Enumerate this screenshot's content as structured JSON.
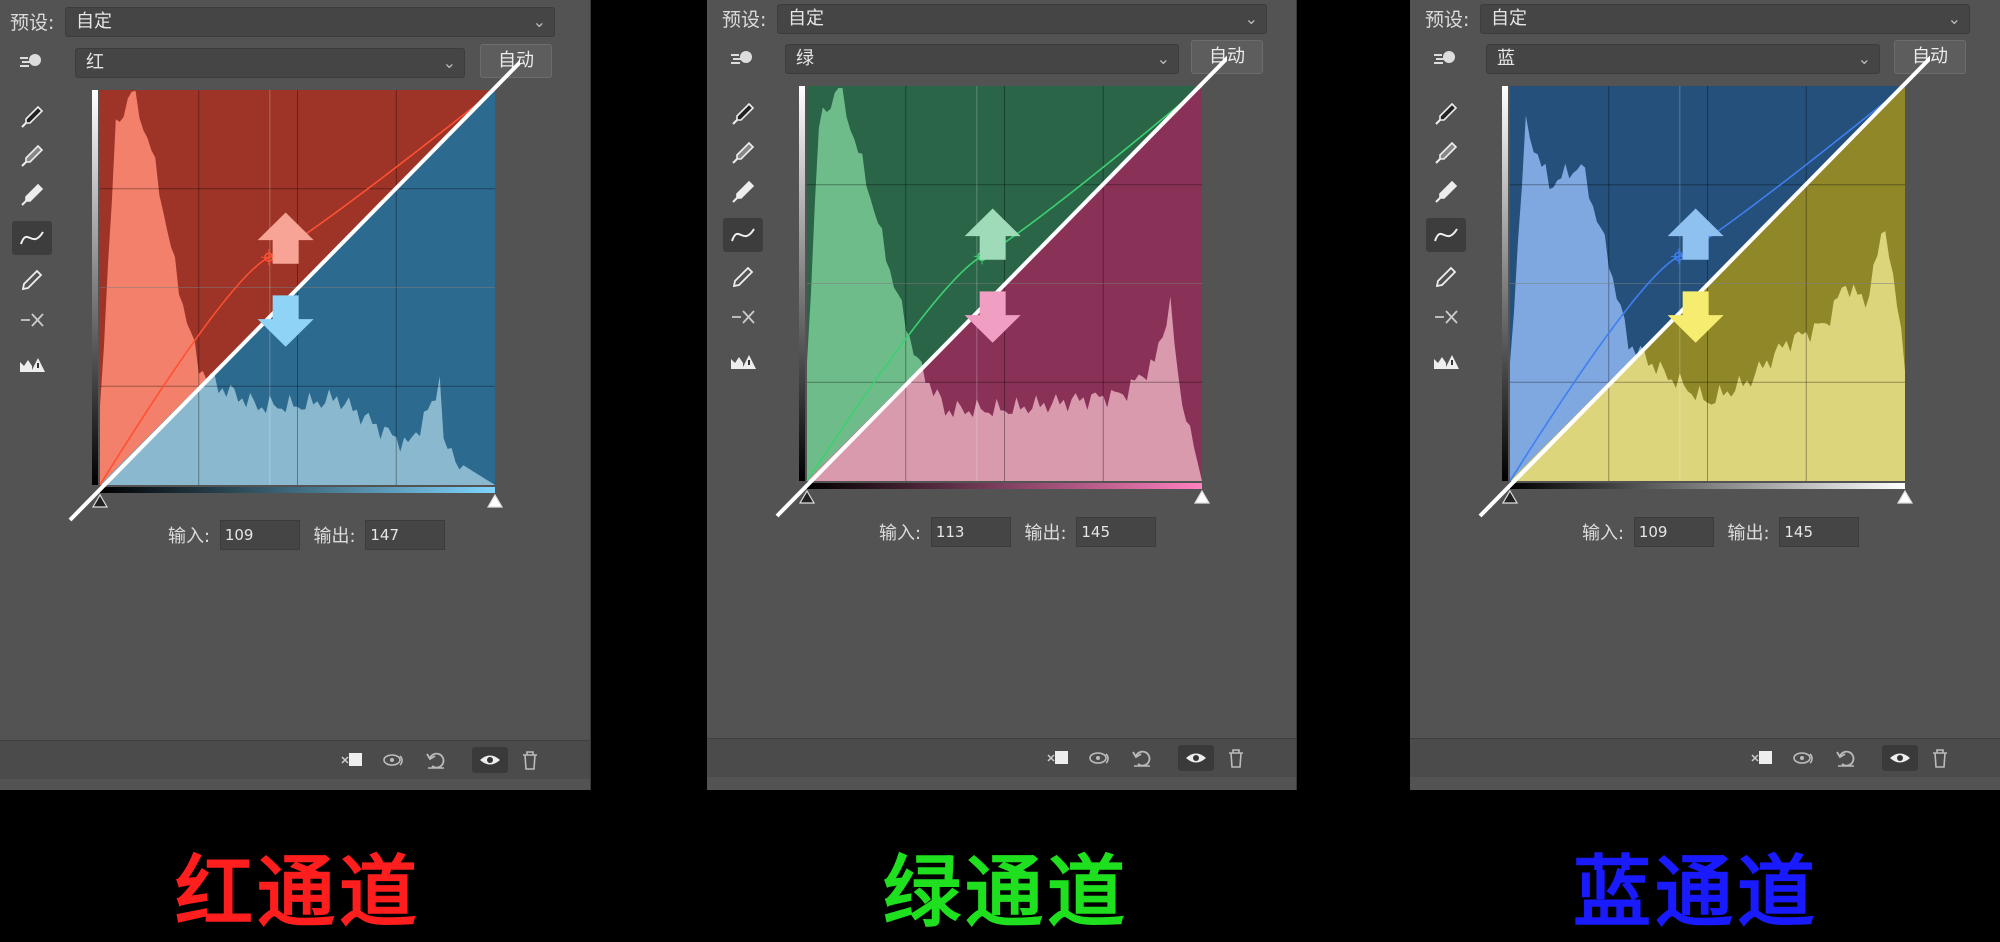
{
  "panels": [
    {
      "preset_label": "预设:",
      "preset_value": "自定",
      "channel": "红",
      "auto_label": "自动",
      "input_label": "输入:",
      "input_value": "109",
      "output_label": "输出:",
      "output_value": "147",
      "upper_color": "#9e3428",
      "lower_color": "#2d6a8f",
      "hist_upper_color": "#f3806a",
      "hist_lower_color": "#8ab9cf",
      "curve_color": "#ff5030",
      "arrow_up_color": "#f7a496",
      "arrow_down_color": "#8fd3f6",
      "gradient_end": "#7fd6ff",
      "caption": "红通道",
      "caption_color": "#ff1e1e"
    },
    {
      "preset_label": "预设:",
      "preset_value": "自定",
      "channel": "绿",
      "auto_label": "自动",
      "input_label": "输入:",
      "input_value": "113",
      "output_label": "输出:",
      "output_value": "145",
      "upper_color": "#2a6548",
      "lower_color": "#8a3158",
      "hist_upper_color": "#6fbc8b",
      "hist_lower_color": "#d99aae",
      "curve_color": "#3cd070",
      "arrow_up_color": "#9fdbb8",
      "arrow_down_color": "#f19ec3",
      "gradient_end": "#ff80c0",
      "caption": "绿通道",
      "caption_color": "#1ee01e"
    },
    {
      "preset_label": "预设:",
      "preset_value": "自定",
      "channel": "蓝",
      "auto_label": "自动",
      "input_label": "输入:",
      "input_value": "109",
      "output_label": "输出:",
      "output_value": "145",
      "upper_color": "#24507b",
      "lower_color": "#8f8728",
      "hist_upper_color": "#7fa8e0",
      "hist_lower_color": "#ddd57c",
      "curve_color": "#3f7ff0",
      "arrow_up_color": "#8ec0f0",
      "arrow_down_color": "#f5ec70",
      "gradient_end": "#ffffff",
      "caption": "蓝通道",
      "caption_color": "#1a1aff"
    }
  ]
}
